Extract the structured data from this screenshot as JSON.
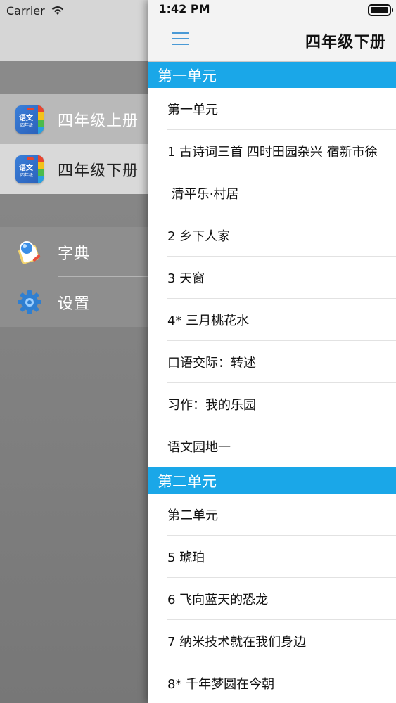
{
  "status_bar": {
    "carrier": "Carrier",
    "time": "1:42 PM"
  },
  "drawer": {
    "grades": [
      {
        "label": "四年级上册",
        "icon": "book-cover-icon",
        "icon_text": "语文",
        "icon_sub": "四年级"
      },
      {
        "label": "四年级下册",
        "icon": "book-cover-icon",
        "icon_text": "语文",
        "icon_sub": "四年级"
      }
    ],
    "tools": [
      {
        "label": "字典",
        "icon": "dictionary-icon"
      },
      {
        "label": "设置",
        "icon": "gear-icon"
      }
    ]
  },
  "nav": {
    "title": "四年级下册",
    "menu_icon": "hamburger-menu-icon"
  },
  "sections": [
    {
      "title": "第一单元",
      "items": [
        "第一单元",
        "1 古诗词三首 四时田园杂兴 宿新市徐",
        " 清平乐·村居",
        "2 乡下人家",
        "3 天窗",
        "4* 三月桃花水",
        "口语交际：转述",
        "习作：我的乐园",
        "语文园地一"
      ]
    },
    {
      "title": "第二单元",
      "items": [
        "第二单元",
        "5 琥珀",
        "6 飞向蓝天的恐龙",
        "7 纳米技术就在我们身边",
        "8* 千年梦圆在今朝"
      ]
    }
  ],
  "colors": {
    "accent": "#1aa7e8",
    "menu_icon": "#4a9ad6"
  }
}
